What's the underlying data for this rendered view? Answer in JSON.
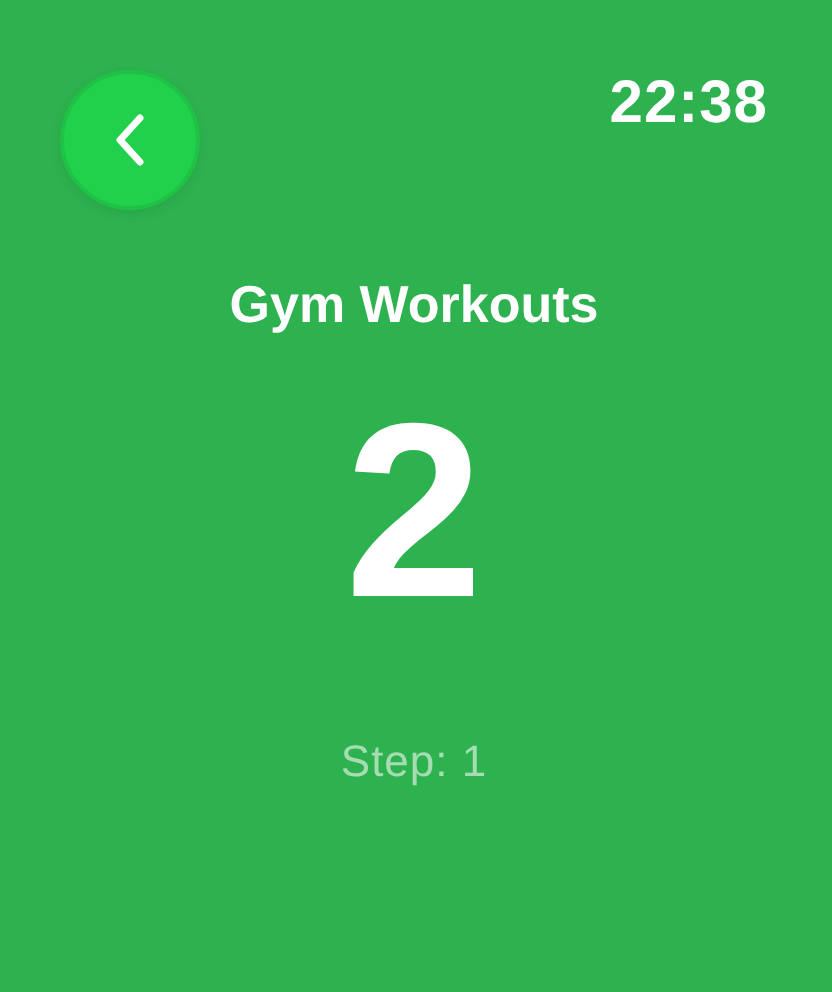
{
  "status_bar": {
    "time": "22:38"
  },
  "title": "Gym Workouts",
  "count": "2",
  "step": "Step: 1"
}
